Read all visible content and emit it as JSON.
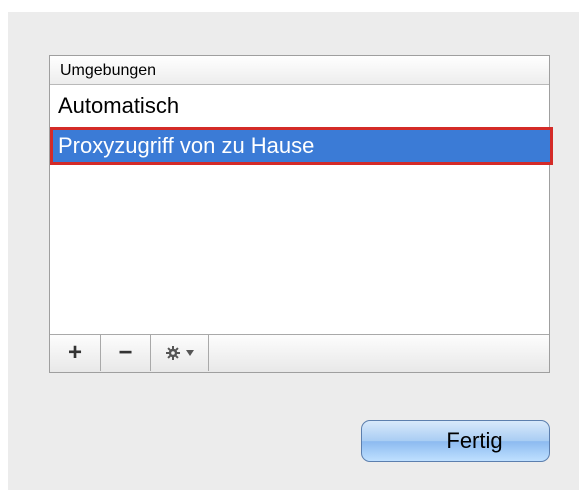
{
  "list": {
    "header": "Umgebungen",
    "items": [
      {
        "label": "Automatisch",
        "selected": false
      },
      {
        "label": "Proxyzugriff von zu Hause",
        "selected": true
      }
    ]
  },
  "toolbar": {
    "add_icon": "plus-icon",
    "remove_icon": "minus-icon",
    "action_icon": "gear-icon"
  },
  "buttons": {
    "done_label": "Fertig"
  },
  "colors": {
    "selection": "#3b7bd6",
    "highlight_border": "#d42b28",
    "button_blue": "#a9cdf3"
  }
}
